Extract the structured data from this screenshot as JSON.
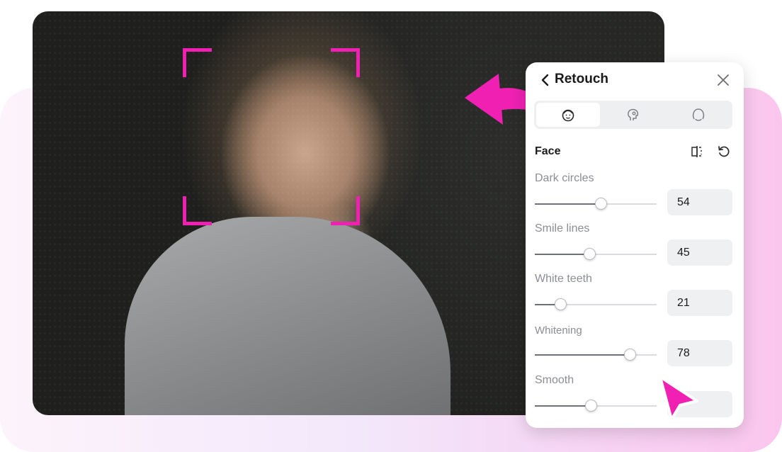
{
  "colors": {
    "accent": "#f021b2",
    "panel_bg": "#ffffff",
    "field_bg": "#eff0f2"
  },
  "panel": {
    "title": "Retouch",
    "tabs": [
      {
        "icon": "face-icon",
        "active": true
      },
      {
        "icon": "face-profile-icon",
        "active": false
      },
      {
        "icon": "head-outline-icon",
        "active": false
      }
    ],
    "section_title": "Face",
    "sliders": [
      {
        "label": "Dark circles",
        "value": "54",
        "fraction": 0.54
      },
      {
        "label": "Smile lines",
        "value": "45",
        "fraction": 0.45
      },
      {
        "label": "White teeth",
        "value": "21",
        "fraction": 0.21
      },
      {
        "label": "Whitening",
        "value": "78",
        "fraction": 0.78
      },
      {
        "label": "Smooth",
        "value": "",
        "fraction": 0.46
      }
    ]
  }
}
